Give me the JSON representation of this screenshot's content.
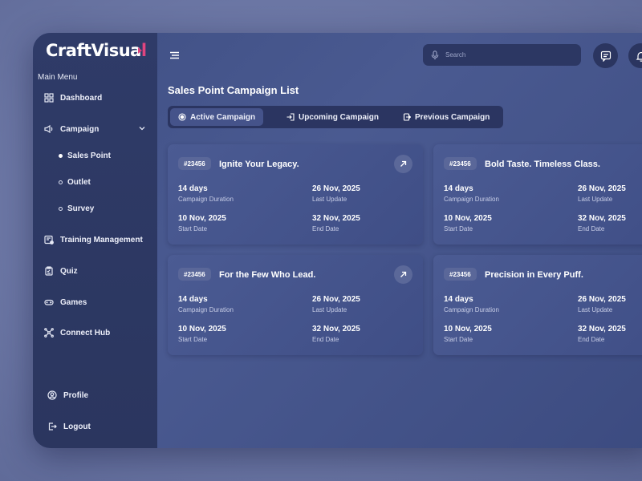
{
  "brand": {
    "name_part1": "CraftVisua",
    "name_part2": "l"
  },
  "sidebar": {
    "heading": "Main Menu",
    "items": [
      {
        "label": "Dashboard",
        "icon": "grid-icon"
      },
      {
        "label": "Campaign",
        "icon": "megaphone-icon"
      },
      {
        "label": "Training Management",
        "icon": "training-icon"
      },
      {
        "label": "Quiz",
        "icon": "clipboard-icon"
      },
      {
        "label": "Games",
        "icon": "gamepad-icon"
      },
      {
        "label": "Connect Hub",
        "icon": "network-icon"
      }
    ],
    "campaign_sub": [
      "Sales Point",
      "Outlet",
      "Survey"
    ],
    "bottom": [
      {
        "label": "Profile",
        "icon": "user-icon"
      },
      {
        "label": "Logout",
        "icon": "logout-icon"
      }
    ]
  },
  "search": {
    "placeholder": "Search"
  },
  "page": {
    "title": "Sales Point Campaign List"
  },
  "tabs": [
    "Active Campaign",
    "Upcoming Campaign",
    "Previous Campaign"
  ],
  "cards": [
    {
      "id": "#23456",
      "title": "Ignite Your Legacy.",
      "duration": "14 days",
      "duration_label": "Campaign Duration",
      "last_update": "26 Nov, 2025",
      "last_update_label": "Last Update",
      "start": "10 Nov, 2025",
      "start_label": "Start Date",
      "end": "32 Nov, 2025",
      "end_label": "End Date"
    },
    {
      "id": "#23456",
      "title": "Bold Taste. Timeless Class.",
      "duration": "14 days",
      "duration_label": "Campaign Duration",
      "last_update": "26 Nov, 2025",
      "last_update_label": "Last Update",
      "start": "10 Nov, 2025",
      "start_label": "Start Date",
      "end": "32 Nov, 2025",
      "end_label": "End Date"
    },
    {
      "id": "#23456",
      "title": "For the Few Who Lead.",
      "duration": "14 days",
      "duration_label": "Campaign Duration",
      "last_update": "26 Nov, 2025",
      "last_update_label": "Last Update",
      "start": "10 Nov, 2025",
      "start_label": "Start Date",
      "end": "32 Nov, 2025",
      "end_label": "End Date"
    },
    {
      "id": "#23456",
      "title": "Precision in Every Puff.",
      "duration": "14 days",
      "duration_label": "Campaign Duration",
      "last_update": "26 Nov, 2025",
      "last_update_label": "Last Update",
      "start": "10 Nov, 2025",
      "start_label": "Start Date",
      "end": "32 Nov, 2025",
      "end_label": "End Date"
    }
  ],
  "colors": {
    "accent": "#e0457f",
    "sidebar": "#2e3a66",
    "card": "#46558d"
  }
}
